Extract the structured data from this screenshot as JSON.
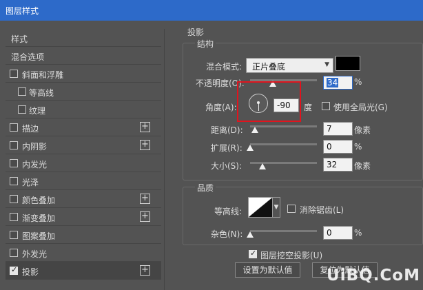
{
  "window": {
    "title": "图层样式"
  },
  "sidebar": {
    "items": [
      {
        "label": "样式",
        "checkbox": false,
        "checked": false,
        "plus": false,
        "selected": false
      },
      {
        "label": "混合选项",
        "checkbox": false,
        "checked": false,
        "plus": false,
        "selected": false
      },
      {
        "label": "斜面和浮雕",
        "checkbox": true,
        "checked": false,
        "plus": false,
        "selected": false
      },
      {
        "label": "等高线",
        "checkbox": true,
        "checked": false,
        "plus": false,
        "selected": false,
        "indent": true
      },
      {
        "label": "纹理",
        "checkbox": true,
        "checked": false,
        "plus": false,
        "selected": false,
        "indent": true
      },
      {
        "label": "描边",
        "checkbox": true,
        "checked": false,
        "plus": true,
        "selected": false
      },
      {
        "label": "内阴影",
        "checkbox": true,
        "checked": false,
        "plus": true,
        "selected": false
      },
      {
        "label": "内发光",
        "checkbox": true,
        "checked": false,
        "plus": false,
        "selected": false
      },
      {
        "label": "光泽",
        "checkbox": true,
        "checked": false,
        "plus": false,
        "selected": false
      },
      {
        "label": "颜色叠加",
        "checkbox": true,
        "checked": false,
        "plus": true,
        "selected": false
      },
      {
        "label": "渐变叠加",
        "checkbox": true,
        "checked": false,
        "plus": true,
        "selected": false
      },
      {
        "label": "图案叠加",
        "checkbox": true,
        "checked": false,
        "plus": false,
        "selected": false
      },
      {
        "label": "外发光",
        "checkbox": true,
        "checked": false,
        "plus": false,
        "selected": false
      },
      {
        "label": "投影",
        "checkbox": true,
        "checked": true,
        "plus": true,
        "selected": true
      }
    ],
    "plus_symbol": "+"
  },
  "panel": {
    "title": "投影",
    "structure": {
      "title": "结构",
      "blend_mode_label": "混合模式:",
      "blend_mode_value": "正片叠底",
      "shadow_color": "#000000",
      "opacity_label": "不透明度(O):",
      "opacity_value": "34",
      "opacity_unit": "%",
      "opacity_level": 0.34,
      "angle_label": "角度(A):",
      "angle_value": "-90",
      "angle_unit": "度",
      "global_light_label": "使用全局光(G)",
      "global_light_checked": false,
      "distance_label": "距离(D):",
      "distance_value": "7",
      "distance_unit": "像素",
      "spread_label": "扩展(R):",
      "spread_value": "0",
      "spread_unit": "%",
      "size_label": "大小(S):",
      "size_value": "32",
      "size_unit": "像素"
    },
    "quality": {
      "title": "品质",
      "contour_label": "等高线:",
      "antialias_label": "消除锯齿(L)",
      "antialias_checked": false,
      "noise_label": "杂色(N):",
      "noise_value": "0",
      "noise_unit": "%"
    },
    "knockout_label": "图层挖空投影(U)",
    "knockout_checked": true,
    "make_default_label": "设置为默认值",
    "reset_default_label": "复位为默认值"
  },
  "annotation": {
    "highlight_color": "#e0141e"
  },
  "watermark": {
    "text": "UiBQ.CoM"
  }
}
